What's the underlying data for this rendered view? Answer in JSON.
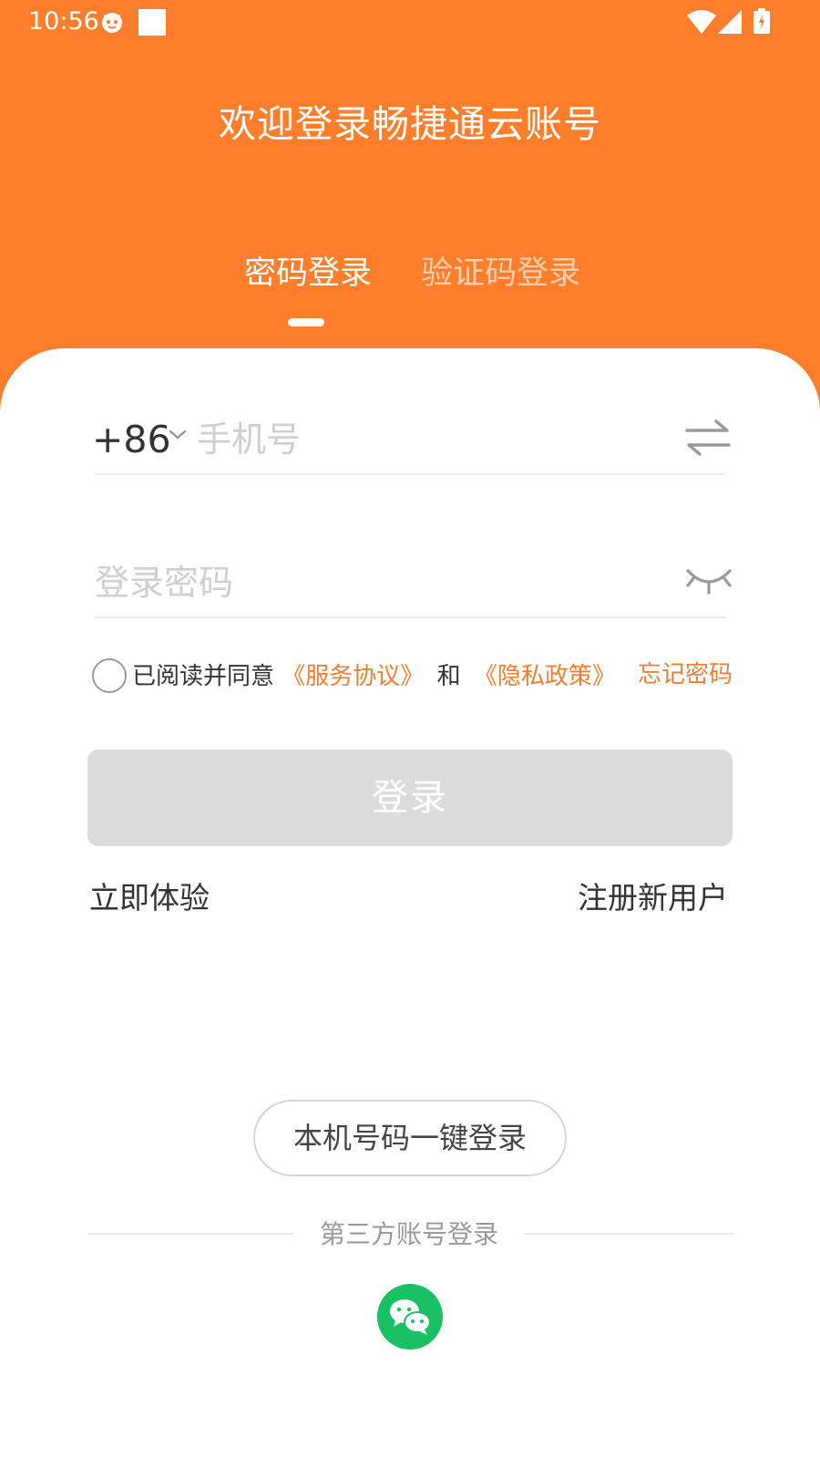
{
  "status_bar": {
    "time": "10:56"
  },
  "header": {
    "welcome_title": "欢迎登录畅捷通云账号"
  },
  "tabs": [
    {
      "label": "密码登录",
      "active": true
    },
    {
      "label": "验证码登录",
      "active": false
    }
  ],
  "phone": {
    "country_code": "+86",
    "placeholder": "手机号"
  },
  "password": {
    "placeholder": "登录密码"
  },
  "agreement": {
    "prefix": "已阅读并同意",
    "service_link": "《服务协议》",
    "and_text": "和",
    "privacy_link": "《隐私政策》",
    "forgot_label": "忘记密码"
  },
  "login_button_label": "登录",
  "links": {
    "try_now": "立即体验",
    "register": "注册新用户"
  },
  "one_key_login_label": "本机号码一键登录",
  "third_party_label": "第三方账号登录",
  "colors": {
    "accent": "#FF7E2B",
    "link": "#F07F34",
    "wechat": "#19C164",
    "disabled_button": "#DCDCDC"
  },
  "icons": {
    "status": [
      "cat-notification-icon",
      "square-notification-icon",
      "wifi-icon",
      "signal-icon",
      "battery-icon"
    ],
    "switch": "switch-arrows-icon",
    "password_visibility": "eye-closed-icon",
    "wechat": "wechat-icon"
  }
}
